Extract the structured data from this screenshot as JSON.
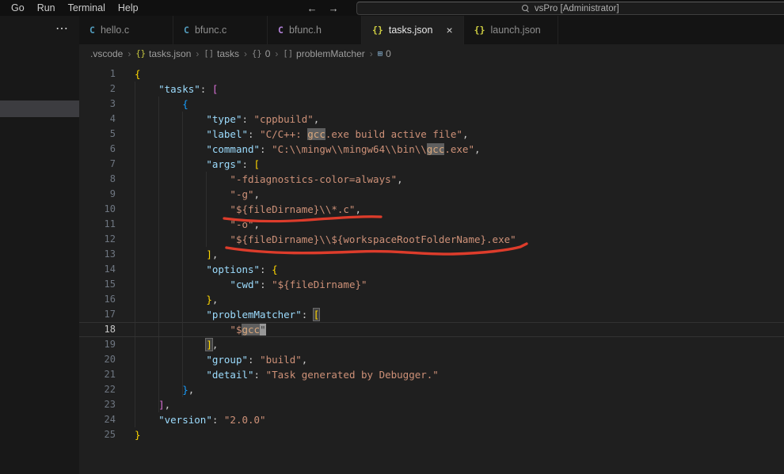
{
  "titlebar": {
    "menus": [
      "Go",
      "Run",
      "Terminal",
      "Help"
    ],
    "back_icon": "←",
    "forward_icon": "→",
    "search": "vsPro [Administrator]"
  },
  "left_rail": {
    "overflow": "⋯"
  },
  "tabs": [
    {
      "label": "hello.c",
      "icon": "C",
      "icon_name": "c-file-icon",
      "icon_color": "#519aba",
      "active": false
    },
    {
      "label": "bfunc.c",
      "icon": "C",
      "icon_name": "c-file-icon",
      "icon_color": "#519aba",
      "active": false
    },
    {
      "label": "bfunc.h",
      "icon": "C",
      "icon_name": "h-file-icon",
      "icon_color": "#b180d7",
      "active": false
    },
    {
      "label": "tasks.json",
      "icon": "{}",
      "icon_name": "json-file-icon",
      "icon_color": "#cbcb41",
      "active": true,
      "close": "×"
    },
    {
      "label": "launch.json",
      "icon": "{}",
      "icon_name": "json-file-icon",
      "icon_color": "#cbcb41",
      "active": false
    }
  ],
  "breadcrumb": {
    "separator": "›",
    "items": [
      {
        "label": ".vscode"
      },
      {
        "icon": "{}",
        "icon_name": "json-file-icon",
        "icon_color": "#cbcb41",
        "label": "tasks.json"
      },
      {
        "icon": "[]",
        "icon_name": "symbol-array-icon",
        "label": "tasks"
      },
      {
        "icon": "{}",
        "icon_name": "symbol-object-icon",
        "label": "0"
      },
      {
        "icon": "[]",
        "icon_name": "symbol-array-icon",
        "label": "problemMatcher"
      },
      {
        "icon": "⊞",
        "icon_name": "symbol-value-icon",
        "icon_color": "#8ab4d4",
        "label": "0"
      }
    ]
  },
  "editor": {
    "current_line": 18,
    "lines": [
      {
        "n": 1,
        "tokens": [
          {
            "c": "g",
            "t": "{"
          }
        ]
      },
      {
        "n": 2,
        "tokens": [
          {
            "c": "w",
            "t": "    "
          },
          {
            "c": "k",
            "t": "\"tasks\""
          },
          {
            "c": "w",
            "t": ": "
          },
          {
            "c": "p",
            "t": "["
          }
        ]
      },
      {
        "n": 3,
        "tokens": [
          {
            "c": "w",
            "t": "        "
          },
          {
            "c": "u",
            "t": "{"
          }
        ]
      },
      {
        "n": 4,
        "tokens": [
          {
            "c": "w",
            "t": "            "
          },
          {
            "c": "k",
            "t": "\"type\""
          },
          {
            "c": "w",
            "t": ": "
          },
          {
            "c": "s",
            "t": "\"cppbuild\""
          },
          {
            "c": "w",
            "t": ","
          }
        ]
      },
      {
        "n": 5,
        "tokens": [
          {
            "c": "w",
            "t": "            "
          },
          {
            "c": "k",
            "t": "\"label\""
          },
          {
            "c": "w",
            "t": ": "
          },
          {
            "c": "s",
            "t": "\"C/C++: "
          },
          {
            "c": "hs",
            "t": "gcc"
          },
          {
            "c": "s",
            "t": ".exe build active file\""
          },
          {
            "c": "w",
            "t": ","
          }
        ]
      },
      {
        "n": 6,
        "tokens": [
          {
            "c": "w",
            "t": "            "
          },
          {
            "c": "k",
            "t": "\"command\""
          },
          {
            "c": "w",
            "t": ": "
          },
          {
            "c": "s",
            "t": "\"C:\\\\mingw\\\\mingw64\\\\bin\\\\"
          },
          {
            "c": "hs",
            "t": "gcc"
          },
          {
            "c": "s",
            "t": ".exe\""
          },
          {
            "c": "w",
            "t": ","
          }
        ]
      },
      {
        "n": 7,
        "tokens": [
          {
            "c": "w",
            "t": "            "
          },
          {
            "c": "k",
            "t": "\"args\""
          },
          {
            "c": "w",
            "t": ": "
          },
          {
            "c": "g",
            "t": "["
          }
        ]
      },
      {
        "n": 8,
        "tokens": [
          {
            "c": "w",
            "t": "                "
          },
          {
            "c": "s",
            "t": "\"-fdiagnostics-color=always\""
          },
          {
            "c": "w",
            "t": ","
          }
        ]
      },
      {
        "n": 9,
        "tokens": [
          {
            "c": "w",
            "t": "                "
          },
          {
            "c": "s",
            "t": "\"-g\""
          },
          {
            "c": "w",
            "t": ","
          }
        ]
      },
      {
        "n": 10,
        "tokens": [
          {
            "c": "w",
            "t": "                "
          },
          {
            "c": "s",
            "t": "\"${fileDirname}\\\\*.c\""
          },
          {
            "c": "w",
            "t": ","
          }
        ]
      },
      {
        "n": 11,
        "tokens": [
          {
            "c": "w",
            "t": "                "
          },
          {
            "c": "s",
            "t": "\"-o\""
          },
          {
            "c": "w",
            "t": ","
          }
        ]
      },
      {
        "n": 12,
        "tokens": [
          {
            "c": "w",
            "t": "                "
          },
          {
            "c": "s",
            "t": "\"${fileDirname}\\\\${workspaceRootFolderName}.exe\""
          }
        ]
      },
      {
        "n": 13,
        "tokens": [
          {
            "c": "w",
            "t": "            "
          },
          {
            "c": "g",
            "t": "]"
          },
          {
            "c": "w",
            "t": ","
          }
        ]
      },
      {
        "n": 14,
        "tokens": [
          {
            "c": "w",
            "t": "            "
          },
          {
            "c": "k",
            "t": "\"options\""
          },
          {
            "c": "w",
            "t": ": "
          },
          {
            "c": "g",
            "t": "{"
          }
        ]
      },
      {
        "n": 15,
        "tokens": [
          {
            "c": "w",
            "t": "                "
          },
          {
            "c": "k",
            "t": "\"cwd\""
          },
          {
            "c": "w",
            "t": ": "
          },
          {
            "c": "s",
            "t": "\"${fileDirname}\""
          }
        ]
      },
      {
        "n": 16,
        "tokens": [
          {
            "c": "w",
            "t": "            "
          },
          {
            "c": "g",
            "t": "}"
          },
          {
            "c": "w",
            "t": ","
          }
        ]
      },
      {
        "n": 17,
        "tokens": [
          {
            "c": "w",
            "t": "            "
          },
          {
            "c": "k",
            "t": "\"problemMatcher\""
          },
          {
            "c": "w",
            "t": ": "
          },
          {
            "c": "bm",
            "t": "["
          }
        ]
      },
      {
        "n": 18,
        "tokens": [
          {
            "c": "w",
            "t": "                "
          },
          {
            "c": "s",
            "t": "\"$"
          },
          {
            "c": "hs",
            "t": "gcc"
          },
          {
            "c": "cur",
            "t": "\""
          }
        ]
      },
      {
        "n": 19,
        "tokens": [
          {
            "c": "w",
            "t": "            "
          },
          {
            "c": "bm",
            "t": "]"
          },
          {
            "c": "w",
            "t": ","
          }
        ]
      },
      {
        "n": 20,
        "tokens": [
          {
            "c": "w",
            "t": "            "
          },
          {
            "c": "k",
            "t": "\"group\""
          },
          {
            "c": "w",
            "t": ": "
          },
          {
            "c": "s",
            "t": "\"build\""
          },
          {
            "c": "w",
            "t": ","
          }
        ]
      },
      {
        "n": 21,
        "tokens": [
          {
            "c": "w",
            "t": "            "
          },
          {
            "c": "k",
            "t": "\"detail\""
          },
          {
            "c": "w",
            "t": ": "
          },
          {
            "c": "s",
            "t": "\"Task generated by Debugger.\""
          }
        ]
      },
      {
        "n": 22,
        "tokens": [
          {
            "c": "w",
            "t": "        "
          },
          {
            "c": "u",
            "t": "}"
          },
          {
            "c": "w",
            "t": ","
          }
        ]
      },
      {
        "n": 23,
        "tokens": [
          {
            "c": "w",
            "t": "    "
          },
          {
            "c": "p",
            "t": "]"
          },
          {
            "c": "w",
            "t": ","
          }
        ]
      },
      {
        "n": 24,
        "tokens": [
          {
            "c": "w",
            "t": "    "
          },
          {
            "c": "k",
            "t": "\"version\""
          },
          {
            "c": "w",
            "t": ": "
          },
          {
            "c": "s",
            "t": "\"2.0.0\""
          }
        ]
      },
      {
        "n": 25,
        "tokens": [
          {
            "c": "g",
            "t": "}"
          }
        ]
      }
    ]
  },
  "annotations": {
    "color": "#dd3c2b"
  }
}
